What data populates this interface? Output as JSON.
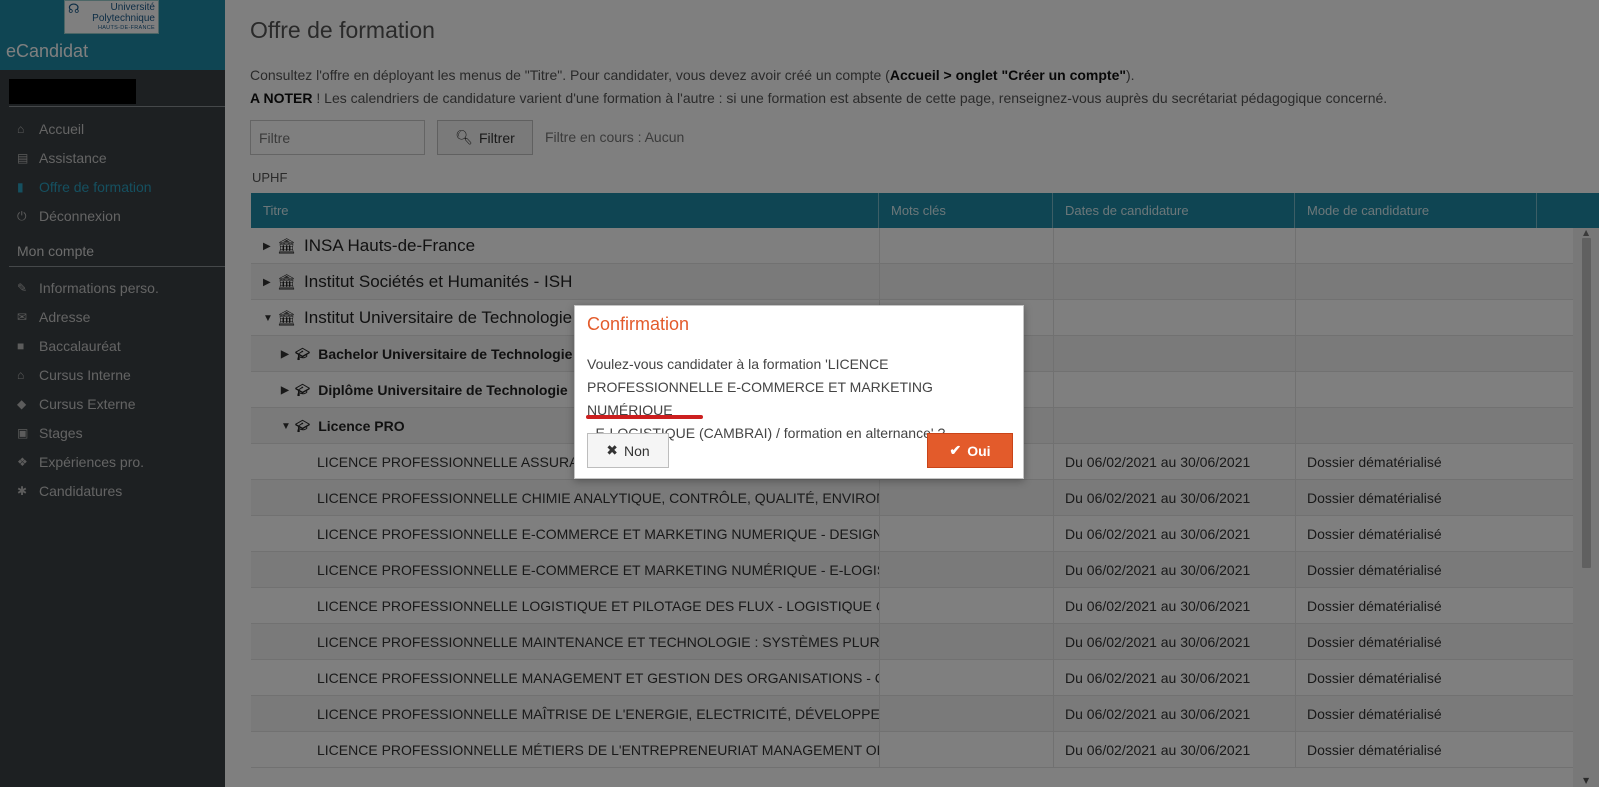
{
  "colors": {
    "header_teal": "#1f8ba6",
    "sidebar_bg": "#3a4044",
    "accent_orange": "#e35b2b",
    "active_link": "#2aa0c0",
    "annotation_red": "#cc1f1f"
  },
  "sidebar": {
    "logo": {
      "line1": "Université",
      "line2": "Polytechnique",
      "line3": "HAUTS-DE-FRANCE"
    },
    "app_name": "eCandidat",
    "menu": [
      {
        "label": "Accueil",
        "icon": "home-icon"
      },
      {
        "label": "Assistance",
        "icon": "truck-icon"
      },
      {
        "label": "Offre de formation",
        "icon": "bookmark-icon",
        "active": true
      },
      {
        "label": "Déconnexion",
        "icon": "power-icon"
      }
    ],
    "account_heading": "Mon compte",
    "account_menu": [
      {
        "label": "Informations perso.",
        "icon": "pencil-icon"
      },
      {
        "label": "Adresse",
        "icon": "mail-icon"
      },
      {
        "label": "Baccalauréat",
        "icon": "ticket-icon"
      },
      {
        "label": "Cursus Interne",
        "icon": "bank-icon"
      },
      {
        "label": "Cursus Externe",
        "icon": "graduation-cap-icon"
      },
      {
        "label": "Stages",
        "icon": "cube-icon"
      },
      {
        "label": "Expériences pro.",
        "icon": "cubes-icon"
      },
      {
        "label": "Candidatures",
        "icon": "asterisk-icon"
      }
    ]
  },
  "main": {
    "title": "Offre de formation",
    "intro_text_1": "Consultez l'offre en déployant les menus de \"Titre\". Pour candidater, vous devez avoir créé un compte (",
    "intro_bold_1": "Accueil > onglet \"Créer un compte\"",
    "intro_text_1_end": ").",
    "intro_bold_2": "A NOTER",
    "intro_text_2": " ! Les calendriers de candidature varient d'une formation à l'autre : si une formation est absente de cette page, renseignez-vous auprès du secrétariat pédagogique concerné.",
    "filter_placeholder": "Filtre",
    "filter_button": "Filtrer",
    "filter_state": "Filtre en cours : Aucun",
    "group_label": "UPHF"
  },
  "table": {
    "headers": [
      "Titre",
      "Mots clés",
      "Dates de candidature",
      "Mode de candidature"
    ],
    "rows": [
      {
        "level": 1,
        "expanded": false,
        "title": "INSA Hauts-de-France",
        "dates": "",
        "mode": ""
      },
      {
        "level": 1,
        "expanded": false,
        "title": "Institut Sociétés et Humanités - ISH",
        "dates": "",
        "mode": ""
      },
      {
        "level": 1,
        "expanded": true,
        "title": "Institut Universitaire de Technologie",
        "dates": "",
        "mode": ""
      },
      {
        "level": 2,
        "expanded": false,
        "title": "Bachelor Universitaire de Technologie",
        "dates": "",
        "mode": ""
      },
      {
        "level": 2,
        "expanded": false,
        "title": "Diplôme Universitaire de Technologie",
        "dates": "",
        "mode": ""
      },
      {
        "level": 2,
        "expanded": true,
        "title": "Licence PRO",
        "dates": "",
        "mode": ""
      },
      {
        "level": 3,
        "title": "LICENCE PROFESSIONNELLE ASSURANCE",
        "dates": "Du 06/02/2021 au 30/06/2021",
        "mode": "Dossier dématérialisé"
      },
      {
        "level": 3,
        "title": "LICENCE PROFESSIONNELLE CHIMIE ANALYTIQUE, CONTRÔLE, QUALITÉ, ENVIRONNEMENT",
        "dates": "Du 06/02/2021 au 30/06/2021",
        "mode": "Dossier dématérialisé"
      },
      {
        "level": 3,
        "title": "LICENCE PROFESSIONNELLE E-COMMERCE ET MARKETING NUMERIQUE - DESIGN DIGITAL",
        "dates": "Du 06/02/2021 au 30/06/2021",
        "mode": "Dossier dématérialisé"
      },
      {
        "level": 3,
        "title": "LICENCE PROFESSIONNELLE E-COMMERCE ET MARKETING NUMÉRIQUE - E-LOGISTIQUE",
        "dates": "Du 06/02/2021 au 30/06/2021",
        "mode": "Dossier dématérialisé"
      },
      {
        "level": 3,
        "title": "LICENCE PROFESSIONNELLE LOGISTIQUE ET PILOTAGE DES FLUX - LOGISTIQUE GLOBALE",
        "dates": "Du 06/02/2021 au 30/06/2021",
        "mode": "Dossier dématérialisé"
      },
      {
        "level": 3,
        "title": "LICENCE PROFESSIONNELLE MAINTENANCE ET TECHNOLOGIE : SYSTÈMES PLURITECHNIQUES",
        "dates": "Du 06/02/2021 au 30/06/2021",
        "mode": "Dossier dématérialisé"
      },
      {
        "level": 3,
        "title": "LICENCE PROFESSIONNELLE MANAGEMENT ET GESTION DES ORGANISATIONS - Commerce",
        "dates": "Du 06/02/2021 au 30/06/2021",
        "mode": "Dossier dématérialisé"
      },
      {
        "level": 3,
        "title": "LICENCE PROFESSIONNELLE MAÎTRISE DE L'ENERGIE, ELECTRICITÉ, DÉVELOPPEMENT DURABLE",
        "dates": "Du 06/02/2021 au 30/06/2021",
        "mode": "Dossier dématérialisé"
      },
      {
        "level": 3,
        "title": "LICENCE PROFESSIONNELLE MÉTIERS DE L'ENTREPRENEURIAT MANAGEMENT OPÉRATIONNEL",
        "dates": "Du 06/02/2021 au 30/06/2021",
        "mode": "Dossier dématérialisé"
      }
    ]
  },
  "dialog": {
    "title": "Confirmation",
    "message_line1": "Voulez-vous candidater à la formation 'LICENCE",
    "message_line2": "PROFESSIONNELLE E-COMMERCE ET MARKETING NUMÉRIQUE",
    "message_line3": "- E-LOGISTIQUE (CAMBRAI) / formation en alternance' ?",
    "no_label": "Non",
    "yes_label": "Oui"
  }
}
